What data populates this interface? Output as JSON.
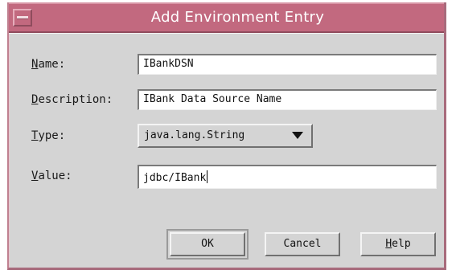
{
  "window": {
    "title": "Add Environment Entry",
    "menu_icon": "window-menu-icon"
  },
  "form": {
    "name": {
      "mnemonic": "N",
      "label_rest": "ame:",
      "value": "IBankDSN"
    },
    "description": {
      "mnemonic": "D",
      "label_rest": "escription:",
      "value": "IBank Data Source Name"
    },
    "type": {
      "mnemonic": "T",
      "label_rest": "ype:",
      "value": "java.lang.String",
      "dropdown_icon": "dropdown-arrow-icon"
    },
    "value": {
      "mnemonic": "V",
      "label_rest": "alue:",
      "value": "jdbc/IBank"
    }
  },
  "buttons": {
    "ok": "OK",
    "cancel": "Cancel",
    "help_mnemonic": "H",
    "help_rest": "elp"
  },
  "colors": {
    "titlebar": "#c2697f",
    "dialog_bg": "#d4d4d4"
  }
}
